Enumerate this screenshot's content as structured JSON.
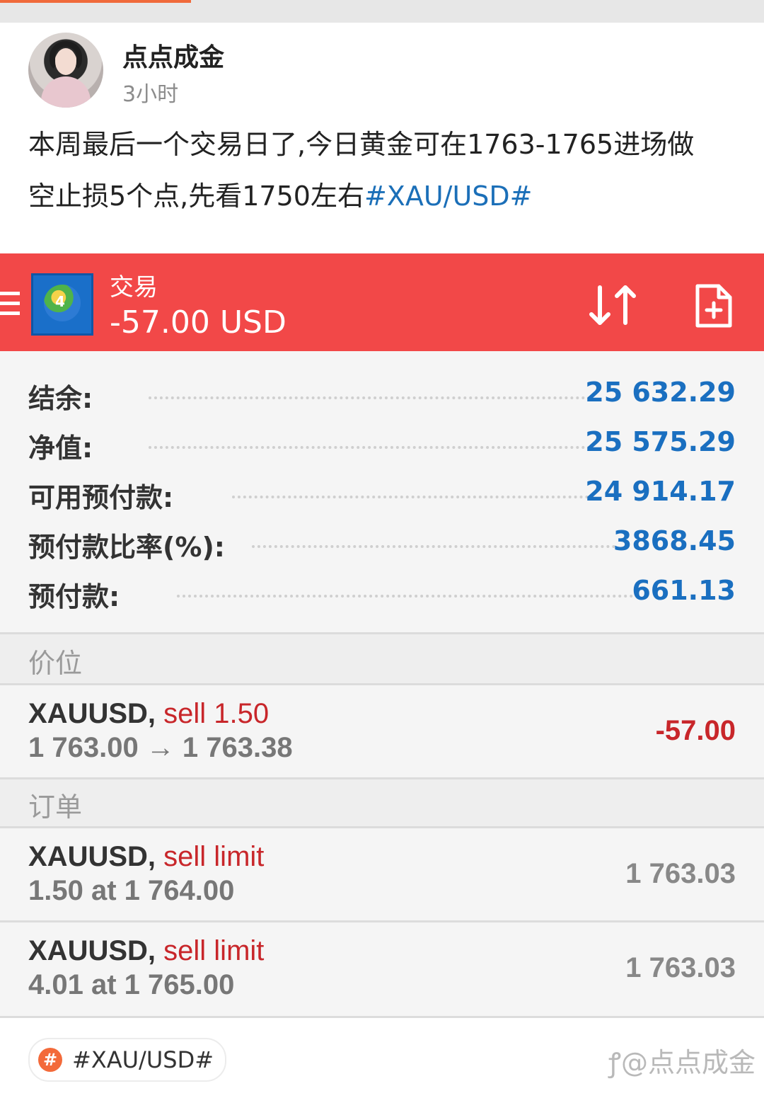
{
  "post": {
    "username": "点点成金",
    "time": "3小时",
    "text_line1": "本周最后一个交易日了,今日黄金可在1763-1765进场做",
    "text_line2_prefix": "空止损5个点,先看1750左右",
    "text_tag": "#XAU/USD#"
  },
  "mt4": {
    "title": "交易",
    "balance_display": "-57.00 USD",
    "icons": {
      "menu": "menu-icon",
      "logo": "metatrader-logo-icon",
      "sort": "sort-icon",
      "new_order": "new-document-icon"
    },
    "account": [
      {
        "label": "结余:",
        "value": "25 632.29"
      },
      {
        "label": "净值:",
        "value": "25 575.29"
      },
      {
        "label": "可用预付款:",
        "value": "24 914.17"
      },
      {
        "label": "预付款比率(%):",
        "value": "3868.45"
      },
      {
        "label": "预付款:",
        "value": "661.13"
      }
    ],
    "positions_header": "价位",
    "position": {
      "symbol": "XAUUSD,",
      "operation": "sell 1.50",
      "prices": "1 763.00 → 1 763.38",
      "profit": "-57.00"
    },
    "orders_header": "订单",
    "orders": [
      {
        "symbol": "XAUUSD,",
        "operation": "sell limit",
        "detail": "1.50 at 1 764.00",
        "price": "1 763.03"
      },
      {
        "symbol": "XAUUSD,",
        "operation": "sell limit",
        "detail": "4.01 at 1 765.00",
        "price": "1 763.03"
      }
    ]
  },
  "footer": {
    "topic_icon": "hash-icon",
    "topic": "#XAU/USD#",
    "watermark": "@点点成金"
  },
  "colors": {
    "header_red": "#f24848",
    "value_blue": "#1a6fc0",
    "sell_red": "#c8262a",
    "tag_blue": "#1b6fb8"
  }
}
